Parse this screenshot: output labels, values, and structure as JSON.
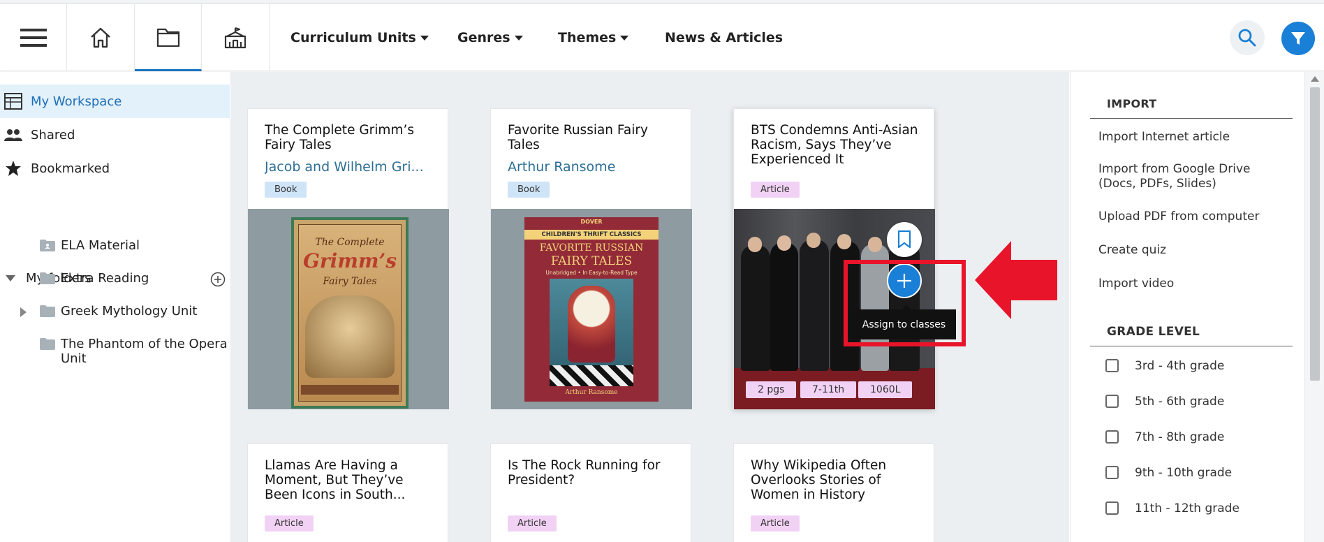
{
  "header": {
    "nav": [
      {
        "label": "Curriculum Units",
        "has_dropdown": true
      },
      {
        "label": "Genres",
        "has_dropdown": true
      },
      {
        "label": "Themes",
        "has_dropdown": true
      },
      {
        "label": "News & Articles",
        "has_dropdown": false
      }
    ],
    "icons": [
      "menu-icon",
      "home-icon",
      "folder-icon",
      "school-icon",
      "search-icon",
      "filter-icon"
    ],
    "active_tab": "folder",
    "accent_color": "#1a7fd6"
  },
  "sidebar": {
    "items": [
      {
        "label": "My Workspace",
        "icon": "workspace-icon",
        "active": true
      },
      {
        "label": "Shared",
        "icon": "people-icon",
        "active": false
      },
      {
        "label": "Bookmarked",
        "icon": "star-icon",
        "active": false
      }
    ],
    "folders_label": "My folders",
    "folders": [
      {
        "label": "ELA Material"
      },
      {
        "label": "Extra Reading"
      },
      {
        "label": "Greek Mythology Unit",
        "expandable": true
      },
      {
        "label": "The Phantom of the Opera Unit"
      }
    ]
  },
  "cards": [
    {
      "title": "The Complete Grimm’s Fairy Tales",
      "author": "Jacob and Wilhelm Gri...",
      "type": "Book",
      "cover": {
        "line1": "The Complete",
        "line2": "Grimm’s",
        "line3": "Fairy Tales"
      }
    },
    {
      "title": "Favorite Russian Fairy Tales",
      "author": "Arthur Ransome",
      "type": "Book",
      "cover": {
        "series": "CHILDREN'S THRIFT CLASSICS",
        "publisher": "DOVER",
        "line1": "FAVORITE RUSSIAN",
        "line2": "FAIRY TALES",
        "line3": "Unabridged • In Easy-to-Read Type",
        "author": "Arthur Ransome"
      }
    },
    {
      "title": "BTS Condemns Anti-Asian Racism, Says They’ve Experienced It",
      "type": "Article",
      "stats": [
        "2 pgs",
        "7-11th",
        "1060L"
      ]
    },
    {
      "title": "Llamas Are Having a Moment, But They’ve Been Icons in South...",
      "type": "Article"
    },
    {
      "title": "Is The Rock Running for President?",
      "type": "Article"
    },
    {
      "title": "Why Wikipedia Often Overlooks Stories of Women in History",
      "type": "Article"
    }
  ],
  "tooltip": {
    "label": "Assign to classes"
  },
  "filter_panel": {
    "import_heading": "IMPORT",
    "import_links": [
      "Import Internet article",
      "Import from Google Drive (Docs, PDFs, Slides)",
      "Upload PDF from computer",
      "Create quiz",
      "Import video"
    ],
    "grade_heading": "GRADE LEVEL",
    "grades": [
      "3rd - 4th grade",
      "5th - 6th grade",
      "7th - 8th grade",
      "9th - 10th grade",
      "11th - 12th grade"
    ]
  },
  "annotation_color": "#e8142a"
}
